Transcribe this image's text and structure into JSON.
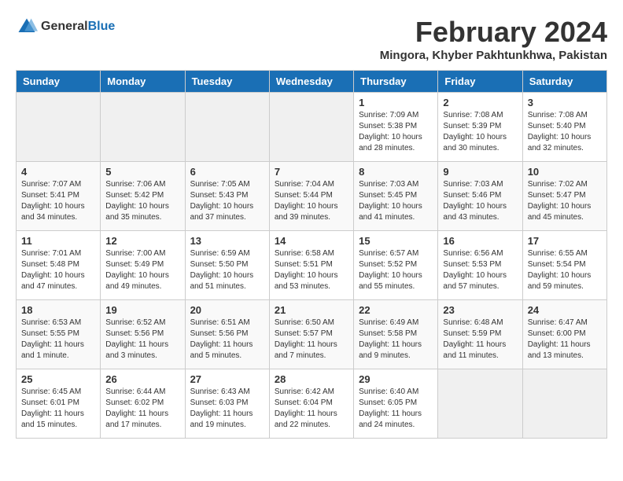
{
  "logo": {
    "general": "General",
    "blue": "Blue"
  },
  "title": "February 2024",
  "subtitle": "Mingora, Khyber Pakhtunkhwa, Pakistan",
  "days_of_week": [
    "Sunday",
    "Monday",
    "Tuesday",
    "Wednesday",
    "Thursday",
    "Friday",
    "Saturday"
  ],
  "weeks": [
    [
      {
        "day": "",
        "info": ""
      },
      {
        "day": "",
        "info": ""
      },
      {
        "day": "",
        "info": ""
      },
      {
        "day": "",
        "info": ""
      },
      {
        "day": "1",
        "info": "Sunrise: 7:09 AM\nSunset: 5:38 PM\nDaylight: 10 hours\nand 28 minutes."
      },
      {
        "day": "2",
        "info": "Sunrise: 7:08 AM\nSunset: 5:39 PM\nDaylight: 10 hours\nand 30 minutes."
      },
      {
        "day": "3",
        "info": "Sunrise: 7:08 AM\nSunset: 5:40 PM\nDaylight: 10 hours\nand 32 minutes."
      }
    ],
    [
      {
        "day": "4",
        "info": "Sunrise: 7:07 AM\nSunset: 5:41 PM\nDaylight: 10 hours\nand 34 minutes."
      },
      {
        "day": "5",
        "info": "Sunrise: 7:06 AM\nSunset: 5:42 PM\nDaylight: 10 hours\nand 35 minutes."
      },
      {
        "day": "6",
        "info": "Sunrise: 7:05 AM\nSunset: 5:43 PM\nDaylight: 10 hours\nand 37 minutes."
      },
      {
        "day": "7",
        "info": "Sunrise: 7:04 AM\nSunset: 5:44 PM\nDaylight: 10 hours\nand 39 minutes."
      },
      {
        "day": "8",
        "info": "Sunrise: 7:03 AM\nSunset: 5:45 PM\nDaylight: 10 hours\nand 41 minutes."
      },
      {
        "day": "9",
        "info": "Sunrise: 7:03 AM\nSunset: 5:46 PM\nDaylight: 10 hours\nand 43 minutes."
      },
      {
        "day": "10",
        "info": "Sunrise: 7:02 AM\nSunset: 5:47 PM\nDaylight: 10 hours\nand 45 minutes."
      }
    ],
    [
      {
        "day": "11",
        "info": "Sunrise: 7:01 AM\nSunset: 5:48 PM\nDaylight: 10 hours\nand 47 minutes."
      },
      {
        "day": "12",
        "info": "Sunrise: 7:00 AM\nSunset: 5:49 PM\nDaylight: 10 hours\nand 49 minutes."
      },
      {
        "day": "13",
        "info": "Sunrise: 6:59 AM\nSunset: 5:50 PM\nDaylight: 10 hours\nand 51 minutes."
      },
      {
        "day": "14",
        "info": "Sunrise: 6:58 AM\nSunset: 5:51 PM\nDaylight: 10 hours\nand 53 minutes."
      },
      {
        "day": "15",
        "info": "Sunrise: 6:57 AM\nSunset: 5:52 PM\nDaylight: 10 hours\nand 55 minutes."
      },
      {
        "day": "16",
        "info": "Sunrise: 6:56 AM\nSunset: 5:53 PM\nDaylight: 10 hours\nand 57 minutes."
      },
      {
        "day": "17",
        "info": "Sunrise: 6:55 AM\nSunset: 5:54 PM\nDaylight: 10 hours\nand 59 minutes."
      }
    ],
    [
      {
        "day": "18",
        "info": "Sunrise: 6:53 AM\nSunset: 5:55 PM\nDaylight: 11 hours\nand 1 minute."
      },
      {
        "day": "19",
        "info": "Sunrise: 6:52 AM\nSunset: 5:56 PM\nDaylight: 11 hours\nand 3 minutes."
      },
      {
        "day": "20",
        "info": "Sunrise: 6:51 AM\nSunset: 5:56 PM\nDaylight: 11 hours\nand 5 minutes."
      },
      {
        "day": "21",
        "info": "Sunrise: 6:50 AM\nSunset: 5:57 PM\nDaylight: 11 hours\nand 7 minutes."
      },
      {
        "day": "22",
        "info": "Sunrise: 6:49 AM\nSunset: 5:58 PM\nDaylight: 11 hours\nand 9 minutes."
      },
      {
        "day": "23",
        "info": "Sunrise: 6:48 AM\nSunset: 5:59 PM\nDaylight: 11 hours\nand 11 minutes."
      },
      {
        "day": "24",
        "info": "Sunrise: 6:47 AM\nSunset: 6:00 PM\nDaylight: 11 hours\nand 13 minutes."
      }
    ],
    [
      {
        "day": "25",
        "info": "Sunrise: 6:45 AM\nSunset: 6:01 PM\nDaylight: 11 hours\nand 15 minutes."
      },
      {
        "day": "26",
        "info": "Sunrise: 6:44 AM\nSunset: 6:02 PM\nDaylight: 11 hours\nand 17 minutes."
      },
      {
        "day": "27",
        "info": "Sunrise: 6:43 AM\nSunset: 6:03 PM\nDaylight: 11 hours\nand 19 minutes."
      },
      {
        "day": "28",
        "info": "Sunrise: 6:42 AM\nSunset: 6:04 PM\nDaylight: 11 hours\nand 22 minutes."
      },
      {
        "day": "29",
        "info": "Sunrise: 6:40 AM\nSunset: 6:05 PM\nDaylight: 11 hours\nand 24 minutes."
      },
      {
        "day": "",
        "info": ""
      },
      {
        "day": "",
        "info": ""
      }
    ]
  ]
}
